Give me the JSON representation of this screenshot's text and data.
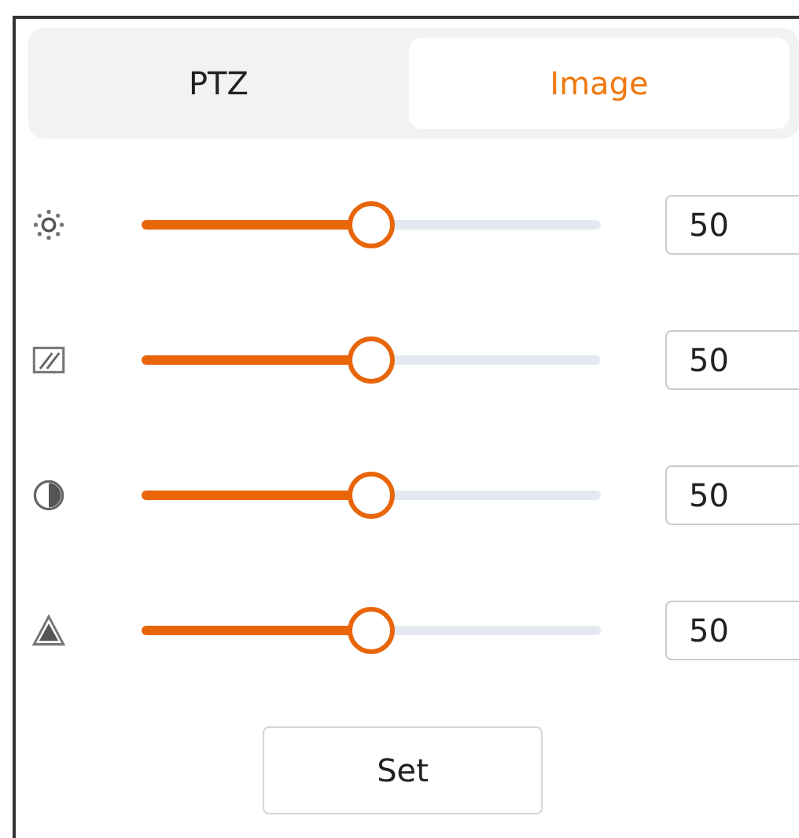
{
  "tabs": [
    {
      "label": "PTZ",
      "selected": false
    },
    {
      "label": "Image",
      "selected": true
    }
  ],
  "sliders": [
    {
      "kind": "sun",
      "level": 0.5,
      "value": "50"
    },
    {
      "kind": "hatch",
      "level": 0.5,
      "value": "50"
    },
    {
      "kind": "half",
      "level": 0.5,
      "value": "50"
    },
    {
      "kind": "triangle",
      "level": 0.5,
      "value": "50"
    }
  ],
  "buttons": [
    "Set"
  ]
}
